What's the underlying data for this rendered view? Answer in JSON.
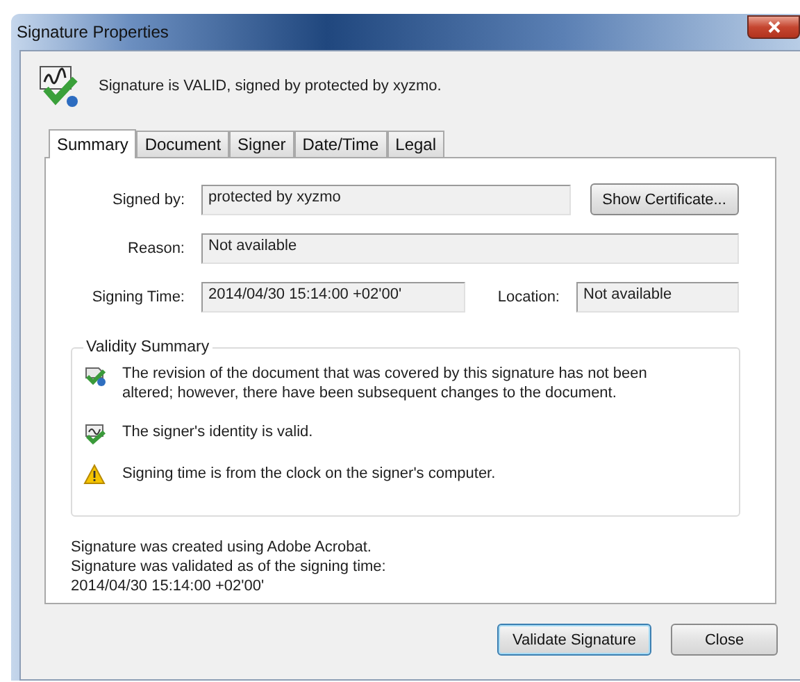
{
  "window": {
    "title": "Signature Properties"
  },
  "header": {
    "status": "Signature is VALID, signed by protected by xyzmo."
  },
  "tabs": [
    {
      "label": "Summary",
      "selected": true
    },
    {
      "label": "Document",
      "selected": false
    },
    {
      "label": "Signer",
      "selected": false
    },
    {
      "label": "Date/Time",
      "selected": false
    },
    {
      "label": "Legal",
      "selected": false
    }
  ],
  "fields": {
    "signed_by": {
      "label": "Signed by:",
      "value": "protected by xyzmo"
    },
    "show_certificate": "Show Certificate...",
    "reason": {
      "label": "Reason:",
      "value": "Not available"
    },
    "signing_time": {
      "label": "Signing Time:",
      "value": "2014/04/30 15:14:00 +02'00'"
    },
    "location": {
      "label": "Location:",
      "value": "Not available"
    }
  },
  "validity_summary": {
    "title": "Validity Summary",
    "items": [
      {
        "kind": "document",
        "text": "The revision of the document that was covered by this signature has not been altered; however, there have been subsequent changes to the document."
      },
      {
        "kind": "identity",
        "text": "The signer's identity is valid."
      },
      {
        "kind": "warning",
        "text": "Signing time is from the clock on the signer's computer."
      }
    ]
  },
  "notes": [
    "Signature was created using Adobe Acrobat.",
    "Signature was validated as of the signing time:",
    "2014/04/30 15:14:00 +02'00'"
  ],
  "buttons": [
    {
      "label": "Validate Signature",
      "default": true
    },
    {
      "label": "Close",
      "default": false
    }
  ]
}
